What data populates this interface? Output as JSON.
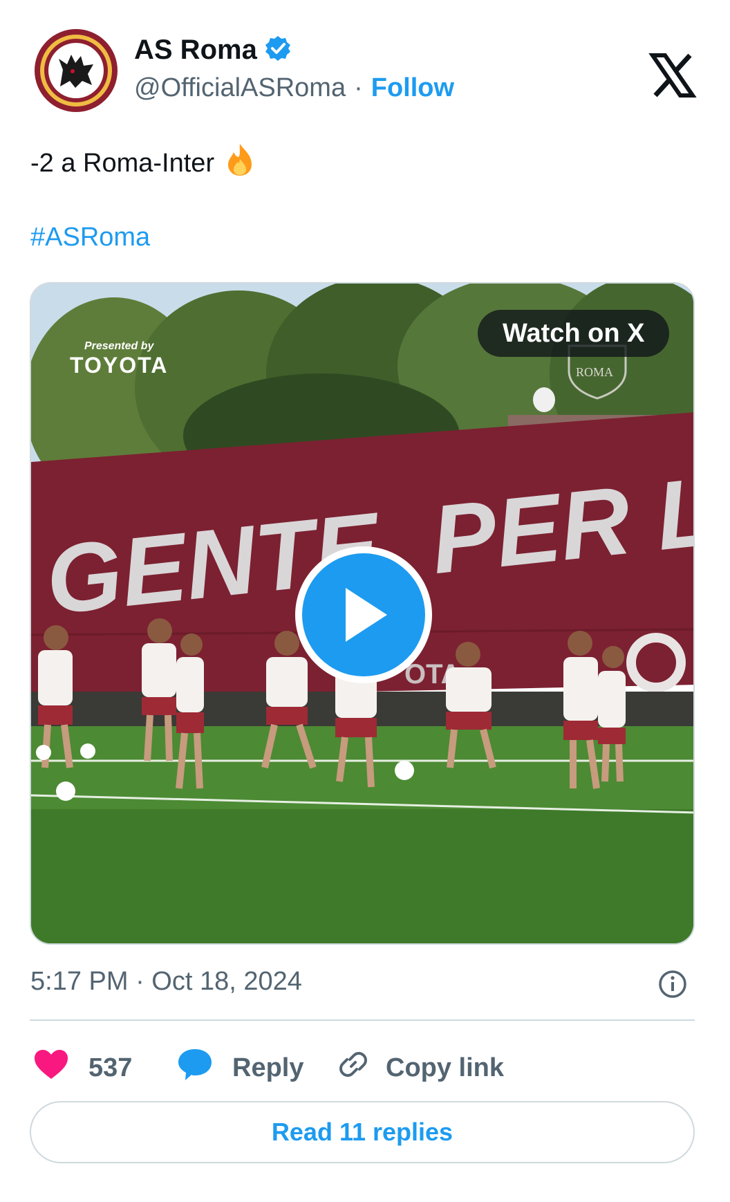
{
  "author": {
    "display_name": "AS Roma",
    "handle": "@OfficialASRoma",
    "separator": "·",
    "follow_label": "Follow",
    "verified": true
  },
  "tweet": {
    "text": "-2 a Roma-Inter",
    "emoji": "🔥",
    "hashtag": "#ASRoma",
    "timestamp": "5:17 PM · Oct 18, 2024"
  },
  "media": {
    "watch_label": "Watch on X",
    "overlay_presented": "Presented by",
    "overlay_sponsor": "TOYOTA",
    "banner_text": "GENTE, PER LA ROM",
    "crest_text": "ROMA"
  },
  "actions": {
    "like_count": "537",
    "reply_label": "Reply",
    "copy_label": "Copy link"
  },
  "read_replies_label": "Read 11 replies",
  "colors": {
    "accent": "#1d9bf0",
    "like": "#f91880",
    "text_secondary": "#536471",
    "roma_red": "#8e1f2f",
    "roma_gold": "#f0bc42"
  },
  "icons": [
    "verified-badge-icon",
    "x-logo-icon",
    "fire-emoji-icon",
    "play-icon",
    "info-icon",
    "heart-icon",
    "reply-bubble-icon",
    "link-icon"
  ]
}
